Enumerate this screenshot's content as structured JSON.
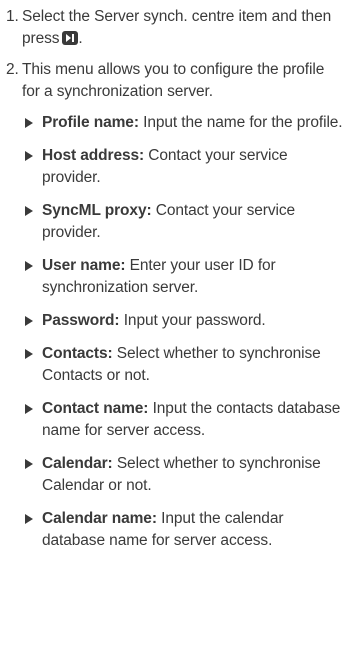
{
  "steps": [
    {
      "num": "1.",
      "text": "Select the Server synch. centre item and then press",
      "end": "."
    },
    {
      "num": "2.",
      "text": "This menu allows you to configure the profile for a synchronization server."
    }
  ],
  "icons": {
    "select_key": "center-select-key-icon",
    "bullet": "triangle-bullet-icon"
  },
  "items": [
    {
      "term": "Profile name:",
      "desc": "Input the name for the profile."
    },
    {
      "term": "Host address:",
      "desc": "Contact your service provider."
    },
    {
      "term": "SyncML proxy:",
      "desc": "Contact your service provider."
    },
    {
      "term": "User name:",
      "desc": "Enter your user ID for synchronization server."
    },
    {
      "term": "Password:",
      "desc": "Input your password."
    },
    {
      "term": "Contacts:",
      "desc": "Select whether to synchronise Contacts or not."
    },
    {
      "term": "Contact name:",
      "desc": "Input the contacts database name for server access."
    },
    {
      "term": "Calendar:",
      "desc": "Select whether to synchronise Calendar or not."
    },
    {
      "term": "Calendar name:",
      "desc": "Input the calendar database name for server access."
    }
  ]
}
